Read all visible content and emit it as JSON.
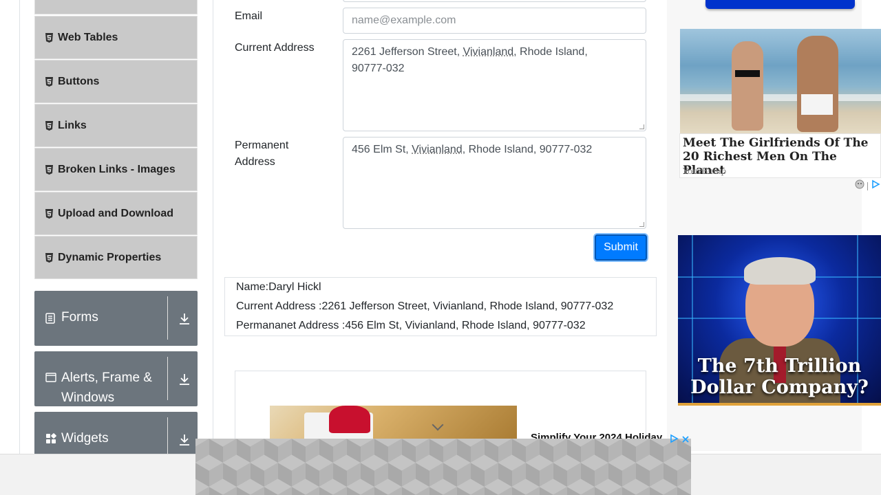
{
  "sidebar": {
    "items": [
      {
        "label": ""
      },
      {
        "label": "Web Tables"
      },
      {
        "label": "Buttons"
      },
      {
        "label": "Links"
      },
      {
        "label": "Broken Links - Images"
      },
      {
        "label": "Upload and Download"
      },
      {
        "label": "Dynamic Properties"
      }
    ],
    "groups": [
      {
        "label": "Forms",
        "icon": "form-icon"
      },
      {
        "label": "Alerts, Frame & Windows",
        "icon": "window-icon"
      },
      {
        "label": "Widgets",
        "icon": "widgets-icon"
      }
    ]
  },
  "form": {
    "email": {
      "label": "Email",
      "placeholder": "name@example.com",
      "value": ""
    },
    "current_address": {
      "label": "Current Address",
      "value_parts": [
        "2261 Jefferson Street, ",
        "Vivianland",
        ", Rhode Island,",
        "90777-032"
      ]
    },
    "permanent_address": {
      "label_line1": "Permanent",
      "label_line2": "Address",
      "value_parts": [
        "456 Elm St, ",
        "Vivianland",
        ", Rhode Island, 90777-032"
      ]
    },
    "submit_label": "Submit"
  },
  "output": {
    "name": "Name:Daryl Hickl",
    "current_address": "Current Address :2261 Jefferson Street, Vivianland, Rhode Island, 90777-032",
    "permanent_address": "Permananet Address :456 Elm St, Vivianland, Rhode Island, 90777-032"
  },
  "ads": {
    "inner_ad_title": "Simplify Your 2024 Holiday",
    "right_headline": "Meet The Girlfriends Of The 20 Richest Men On The Planet",
    "right_source": "YourBump",
    "tech_caption": "The 7th Trillion Dollar Company?"
  },
  "colors": {
    "primary": "#007bff",
    "sidebar_item_bg": "#c9c9c9",
    "group_bg": "#6c757d"
  }
}
